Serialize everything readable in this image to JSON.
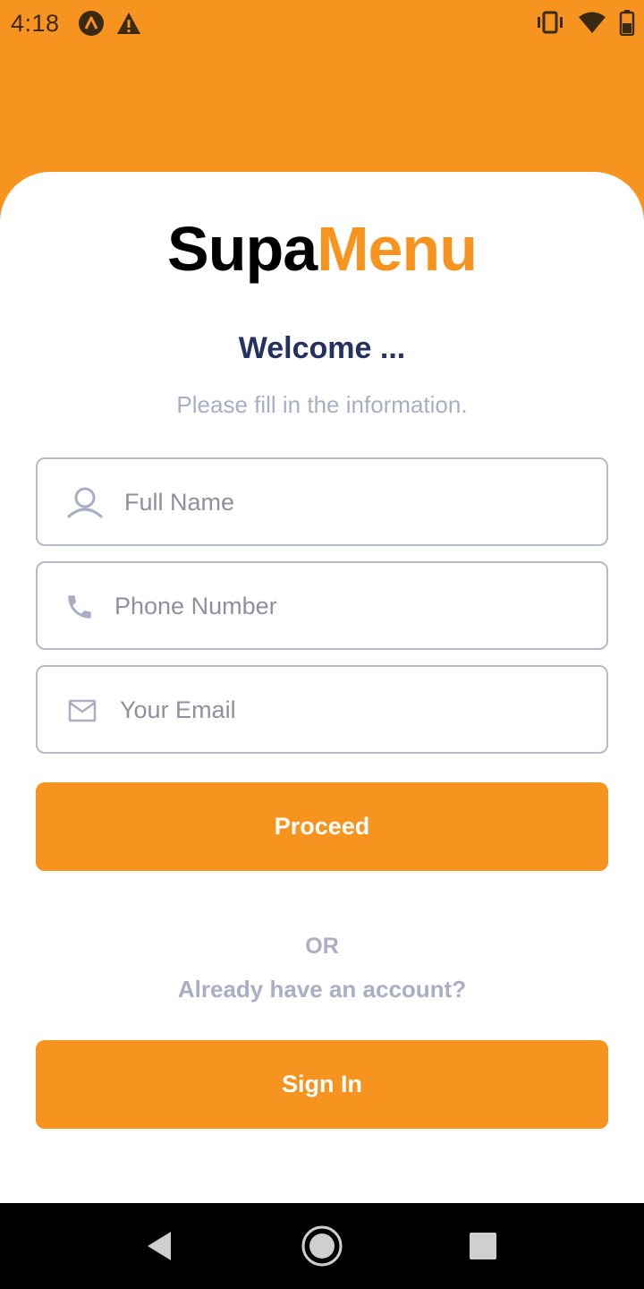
{
  "status_bar": {
    "time": "4:18",
    "left_icons": [
      "app-notification-icon",
      "warning-icon"
    ],
    "right_icons": [
      "vibrate-icon",
      "wifi-icon",
      "battery-icon"
    ]
  },
  "logo": {
    "part1": "Supa",
    "part2": "Menu"
  },
  "heading": "Welcome ...",
  "subtitle": "Please fill in the information.",
  "form": {
    "full_name": {
      "placeholder": "Full Name",
      "value": "",
      "icon": "user-icon"
    },
    "phone": {
      "placeholder": "Phone Number",
      "value": "",
      "icon": "phone-icon"
    },
    "email": {
      "placeholder": "Your Email",
      "value": "",
      "icon": "mail-icon"
    }
  },
  "proceed_label": "Proceed",
  "or_label": "OR",
  "account_prompt": "Already have an account?",
  "sign_in_label": "Sign In",
  "colors": {
    "accent": "#F7941F",
    "heading": "#25315F",
    "muted": "#A9AEC5"
  },
  "nav_bar": {
    "icons": [
      "back-icon",
      "home-icon",
      "recents-icon"
    ]
  }
}
